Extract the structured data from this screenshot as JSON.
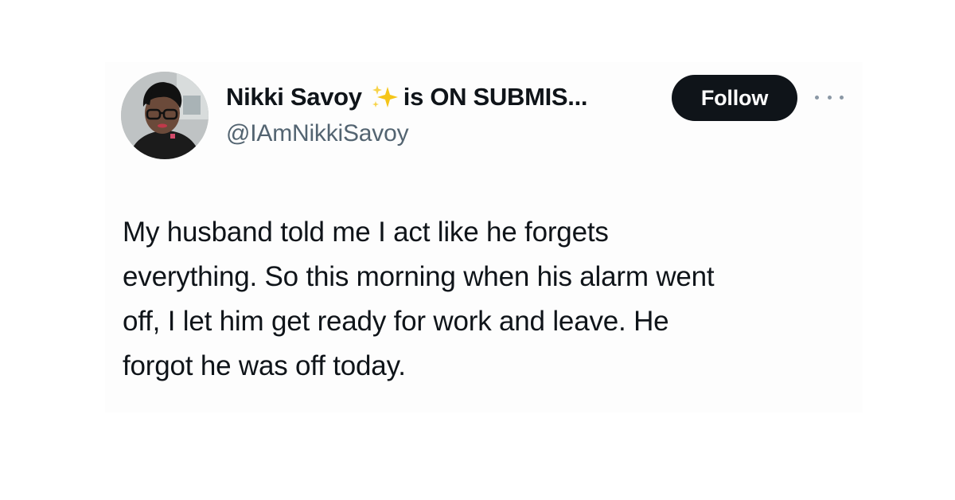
{
  "tweet": {
    "author": {
      "display_name": "Nikki Savoy",
      "name_suffix": "is ON SUBMIS...",
      "handle": "@IAmNikkiSavoy",
      "emoji": "sparkles-icon"
    },
    "follow_label": "Follow",
    "text_lines": [
      "My husband told me I act like he forgets",
      "everything. So this morning when his alarm went",
      "off, I let him get ready for work and leave. He",
      "forgot he was off today."
    ]
  },
  "colors": {
    "text": "#0f1419",
    "secondary_text": "#536471",
    "follow_button_bg": "#0f1419",
    "follow_button_text": "#ffffff",
    "sparkle": "#f5c518"
  }
}
